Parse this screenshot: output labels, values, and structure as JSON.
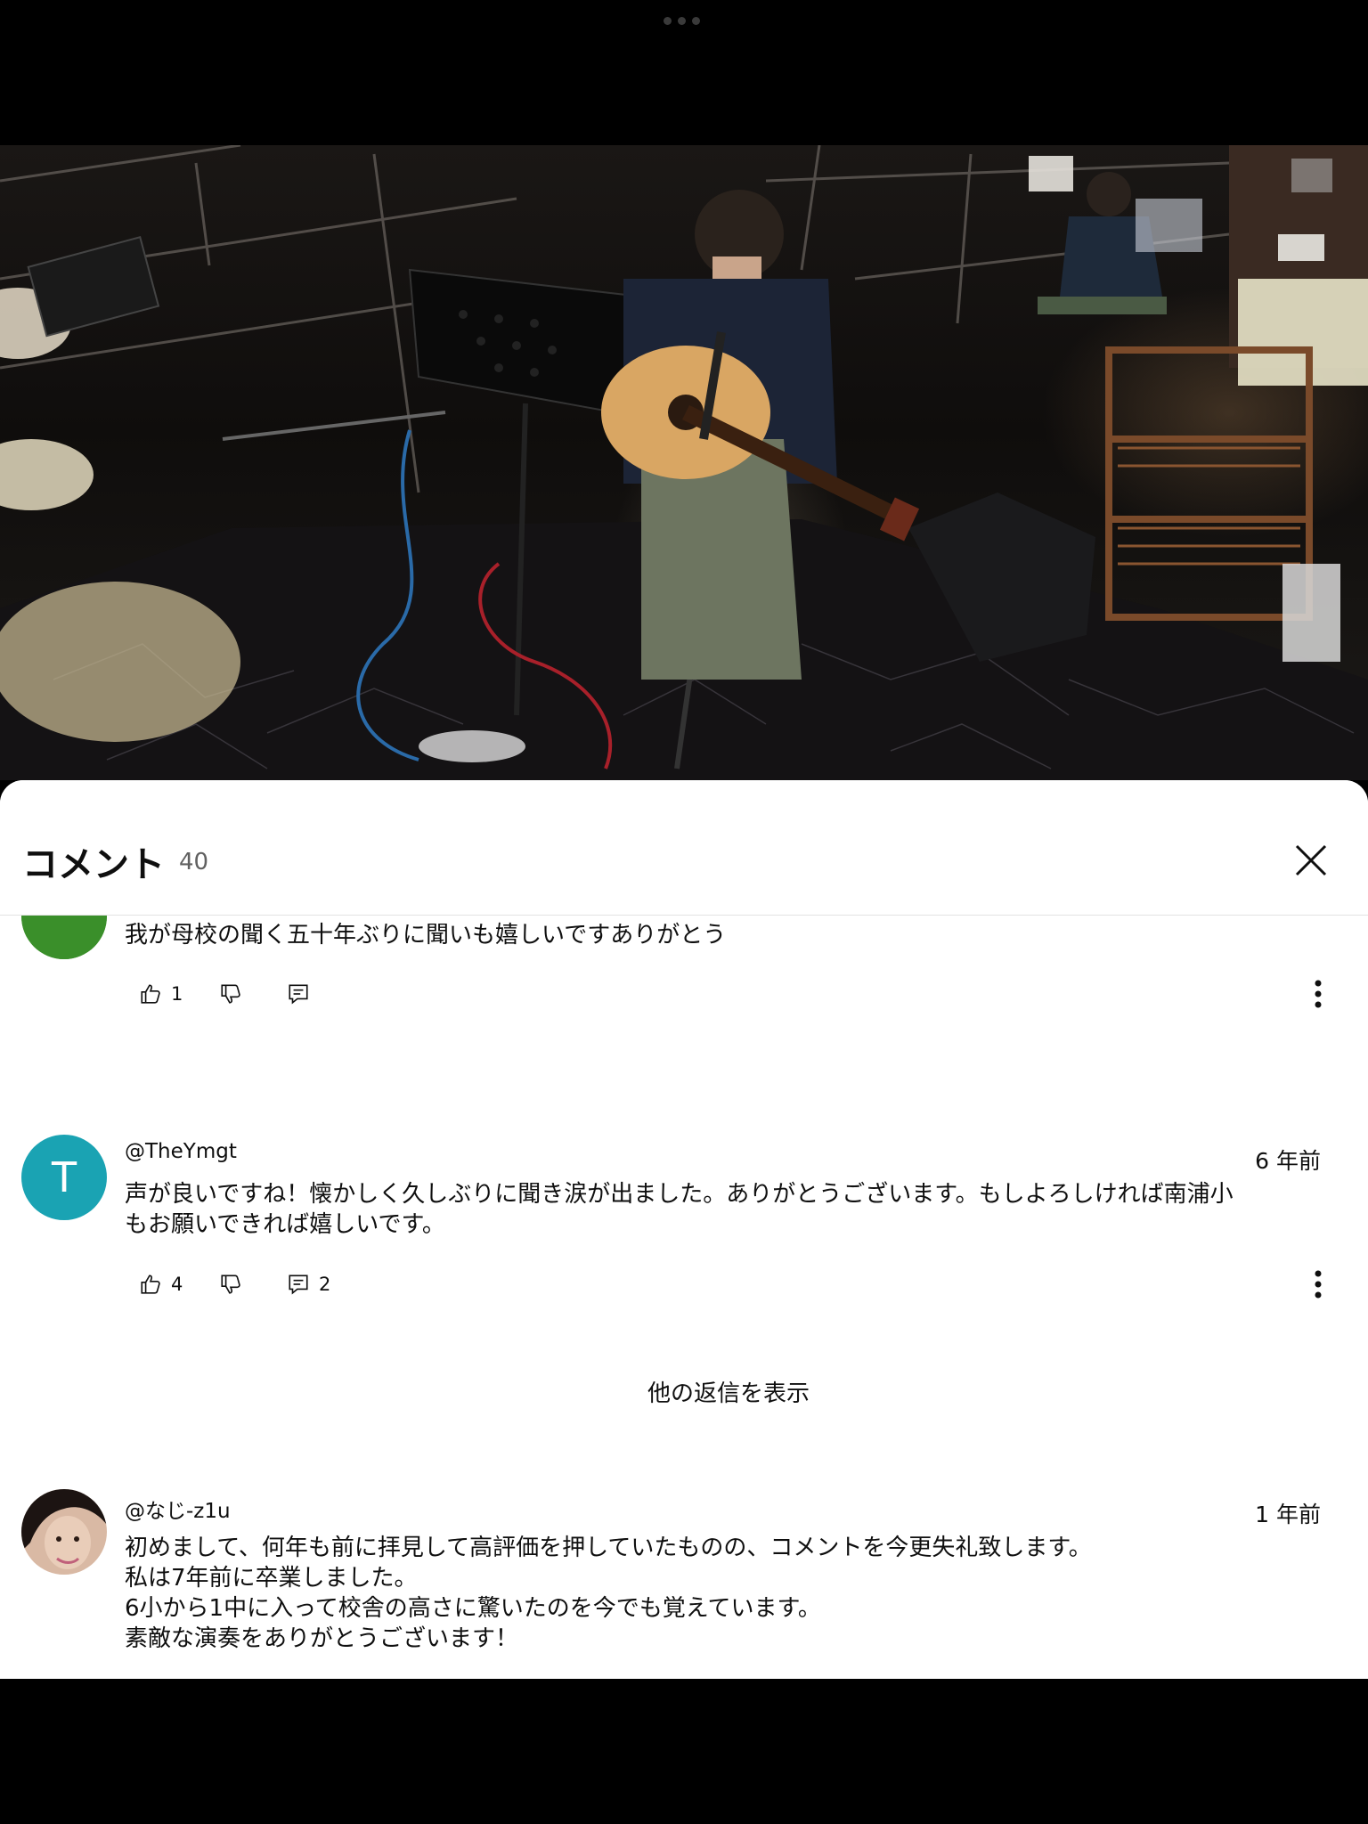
{
  "video": {
    "description_icon": "play-video-frame"
  },
  "sheet": {
    "title": "コメント",
    "count": "40",
    "close_icon": "close-icon"
  },
  "comments": [
    {
      "author": "",
      "time": "",
      "text": "我が母校の聞く五十年ぶりに聞いも嬉しいですありがとう",
      "likes": "1",
      "replies": "",
      "avatar_color": "#3a8f2a"
    },
    {
      "author": "@TheYmgt",
      "time": "6 年前",
      "text": "声が良いですね！懐かしく久しぶりに聞き涙が出ました。ありがとうございます。もしよろしければ南浦小\nもお願いできれば嬉しいです。",
      "likes": "4",
      "replies": "2",
      "avatar_letter": "T",
      "avatar_color": "#1aa3b3"
    },
    {
      "author": "@なじ-z1u",
      "time": "1 年前",
      "text": "初めまして、何年も前に拝見して高評価を押していたものの、コメントを今更失礼致します。\n私は7年前に卒業しました。\n6小から1中に入って校舎の高さに驚いたのを今でも覚えています。\n素敵な演奏をありがとうございます！",
      "avatar_color": "#d9b9a4"
    }
  ],
  "show_replies_label": "他の返信を表示"
}
